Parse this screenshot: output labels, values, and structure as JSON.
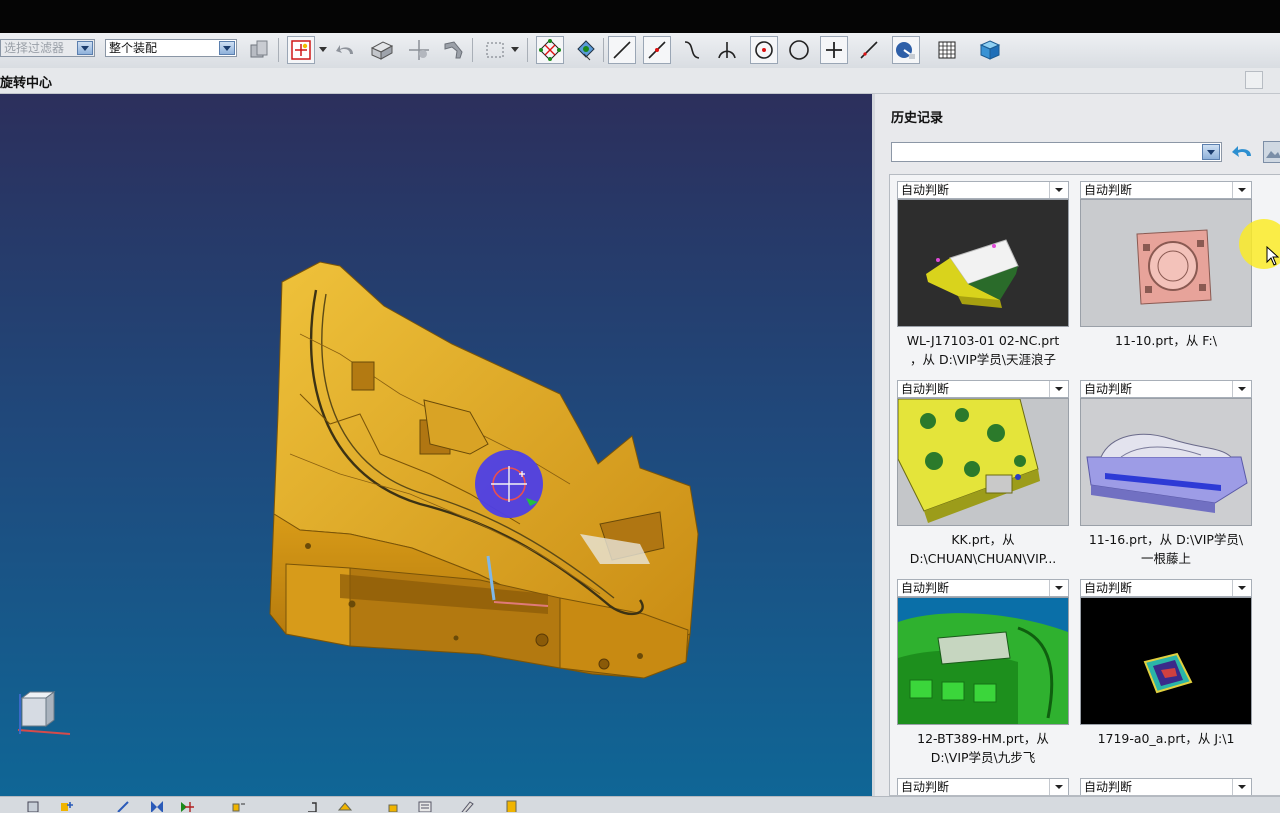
{
  "toolbar": {
    "selection_filter": "选择过滤器",
    "assembly_scope": "整个装配",
    "icons": [
      "snap-icon",
      "select-point-icon",
      "undo-icon",
      "face-icon",
      "vertex-icon",
      "bend-icon",
      "box-select-icon",
      "snap-points-icon",
      "move-icon",
      "line-icon",
      "line-slash-icon",
      "curve-icon",
      "intersect-icon",
      "circle-center-icon",
      "circle-icon",
      "plus-icon",
      "diagonal-icon",
      "view-icon",
      "grid-icon",
      "cube-icon"
    ]
  },
  "view_title": "旋转中心",
  "history_panel": {
    "title": "历史记录",
    "dropdown_value": "",
    "cards": [
      {
        "mode": "自动判断",
        "thumbnail": "model-white-yellow-block",
        "line1": "WL-J17103-01 02-NC.prt",
        "line2": "，从 D:\\VIP学员\\天涯浪子"
      },
      {
        "mode": "自动判断",
        "thumbnail": "model-pink-square-plate",
        "line1": "11-10.prt，从 F:\\",
        "line2": ""
      },
      {
        "mode": "自动判断",
        "thumbnail": "model-yellow-holed-plate",
        "line1": "KK.prt，从",
        "line2": "D:\\CHUAN\\CHUAN\\VIP..."
      },
      {
        "mode": "自动判断",
        "thumbnail": "model-purple-mold-base",
        "line1": "11-16.prt，从 D:\\VIP学员\\",
        "line2": "一根藤上"
      },
      {
        "mode": "自动判断",
        "thumbnail": "model-green-mold-cavity",
        "line1": "12-BT389-HM.prt，从",
        "line2": "D:\\VIP学员\\九步飞"
      },
      {
        "mode": "自动判断",
        "thumbnail": "model-small-colored-part",
        "line1": "1719-a0_a.prt，从 J:\\1",
        "line2": ""
      },
      {
        "mode": "自动判断"
      },
      {
        "mode": "自动判断"
      }
    ]
  },
  "colors": {
    "model": "#d9a21b",
    "viewport_top": "#2c2f5c",
    "viewport_bottom": "#0f6696",
    "rotate_marker": "#4e3fe6",
    "cursor_highlight": "#faeb28"
  }
}
